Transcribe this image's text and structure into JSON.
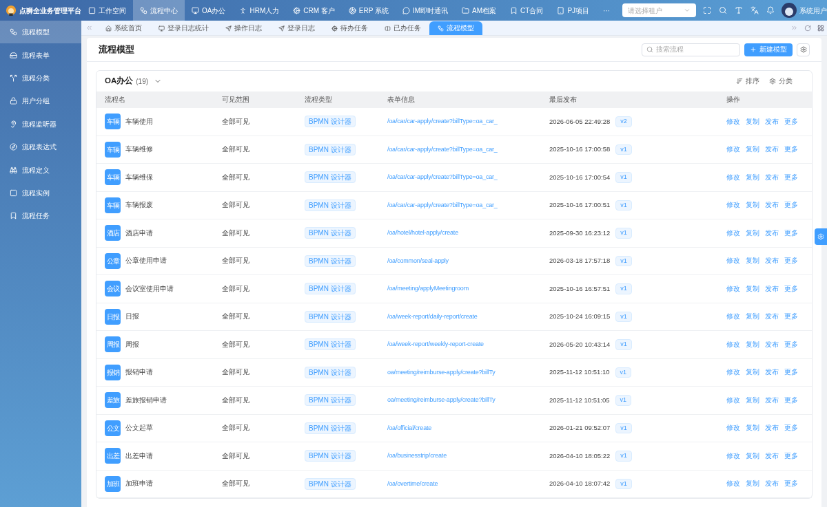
{
  "brand": {
    "title": "点狮全业务管理平台"
  },
  "top_nav": [
    {
      "label": "工作空间",
      "selected": false
    },
    {
      "label": "流程中心",
      "selected": true
    },
    {
      "label": "OA办公",
      "selected": false
    },
    {
      "label": "HRM人力",
      "selected": false
    },
    {
      "label": "CRM 客户",
      "selected": false
    },
    {
      "label": "ERP 系统",
      "selected": false
    },
    {
      "label": "IM即时通讯",
      "selected": false
    },
    {
      "label": "AM档案",
      "selected": false
    },
    {
      "label": "CT合同",
      "selected": false
    },
    {
      "label": "PJ项目",
      "selected": false
    },
    {
      "label": "···",
      "selected": false
    }
  ],
  "tenant_select": {
    "placeholder": "请选择租户"
  },
  "user": {
    "name": "系统用户"
  },
  "sidebar": {
    "items": [
      {
        "label": "流程模型",
        "selected": true
      },
      {
        "label": "流程表单",
        "selected": false
      },
      {
        "label": "流程分类",
        "selected": false
      },
      {
        "label": "用户分组",
        "selected": false
      },
      {
        "label": "流程监听器",
        "selected": false
      },
      {
        "label": "流程表达式",
        "selected": false
      },
      {
        "label": "流程定义",
        "selected": false
      },
      {
        "label": "流程实例",
        "selected": false
      },
      {
        "label": "流程任务",
        "selected": false
      }
    ]
  },
  "tabs": [
    {
      "label": "系统首页",
      "selected": false
    },
    {
      "label": "登录日志统计",
      "selected": false
    },
    {
      "label": "操作日志",
      "selected": false
    },
    {
      "label": "登录日志",
      "selected": false
    },
    {
      "label": "待办任务",
      "selected": false
    },
    {
      "label": "已办任务",
      "selected": false
    },
    {
      "label": "流程模型",
      "selected": true
    }
  ],
  "page": {
    "title": "流程模型",
    "search": {
      "placeholder": "搜索流程"
    },
    "new_button": "新建模型"
  },
  "group": {
    "name": "OA办公",
    "count": "(19)",
    "sort": "排序",
    "category": "分类",
    "columns": [
      "流程名",
      "可见范围",
      "流程类型",
      "表单信息",
      "最后发布",
      "操作"
    ],
    "rows": [
      {
        "badge": "车辆",
        "name": "车辆使用",
        "visibility": "全部可见",
        "type": "BPMN 设计器",
        "form": "/oa/car/car-apply/create?billType=oa_car_",
        "published": "2026-06-05 22:49:28",
        "version": "v2",
        "actions": [
          "修改",
          "复制",
          "发布",
          "更多"
        ]
      },
      {
        "badge": "车辆",
        "name": "车辆维修",
        "visibility": "全部可见",
        "type": "BPMN 设计器",
        "form": "/oa/car/car-apply/create?billType=oa_car_",
        "published": "2025-10-16 17:00:58",
        "version": "v1",
        "actions": [
          "修改",
          "复制",
          "发布",
          "更多"
        ]
      },
      {
        "badge": "车辆",
        "name": "车辆维保",
        "visibility": "全部可见",
        "type": "BPMN 设计器",
        "form": "/oa/car/car-apply/create?billType=oa_car_",
        "published": "2025-10-16 17:00:54",
        "version": "v1",
        "actions": [
          "修改",
          "复制",
          "发布",
          "更多"
        ]
      },
      {
        "badge": "车辆",
        "name": "车辆报废",
        "visibility": "全部可见",
        "type": "BPMN 设计器",
        "form": "/oa/car/car-apply/create?billType=oa_car_",
        "published": "2025-10-16 17:00:51",
        "version": "v1",
        "actions": [
          "修改",
          "复制",
          "发布",
          "更多"
        ]
      },
      {
        "badge": "酒店",
        "name": "酒店申请",
        "visibility": "全部可见",
        "type": "BPMN 设计器",
        "form": "/oa/hotel/hotel-apply/create",
        "published": "2025-09-30 16:23:12",
        "version": "v1",
        "actions": [
          "修改",
          "复制",
          "发布",
          "更多"
        ]
      },
      {
        "badge": "公章",
        "name": "公章使用申请",
        "visibility": "全部可见",
        "type": "BPMN 设计器",
        "form": "/oa/common/seal-apply",
        "published": "2026-03-18 17:57:18",
        "version": "v1",
        "actions": [
          "修改",
          "复制",
          "发布",
          "更多"
        ]
      },
      {
        "badge": "会议",
        "name": "会议室使用申请",
        "visibility": "全部可见",
        "type": "BPMN 设计器",
        "form": "/oa/meeting/applyMeetingroom",
        "published": "2025-10-16 16:57:51",
        "version": "v1",
        "actions": [
          "修改",
          "复制",
          "发布",
          "更多"
        ]
      },
      {
        "badge": "日报",
        "name": "日报",
        "visibility": "全部可见",
        "type": "BPMN 设计器",
        "form": "/oa/week-report/daily-report/create",
        "published": "2025-10-24 16:09:15",
        "version": "v1",
        "actions": [
          "修改",
          "复制",
          "发布",
          "更多"
        ]
      },
      {
        "badge": "周报",
        "name": "周报",
        "visibility": "全部可见",
        "type": "BPMN 设计器",
        "form": "/oa/week-report/weekly-report-create",
        "published": "2026-05-20 10:43:14",
        "version": "v1",
        "actions": [
          "修改",
          "复制",
          "发布",
          "更多"
        ]
      },
      {
        "badge": "报销",
        "name": "报销申请",
        "visibility": "全部可见",
        "type": "BPMN 设计器",
        "form": "oa/meeting/reimburse-apply/create?billTy",
        "published": "2025-11-12 10:51:10",
        "version": "v1",
        "actions": [
          "修改",
          "复制",
          "发布",
          "更多"
        ]
      },
      {
        "badge": "差旅",
        "name": "差旅报销申请",
        "visibility": "全部可见",
        "type": "BPMN 设计器",
        "form": "oa/meeting/reimburse-apply/create?billTy",
        "published": "2025-11-12 10:51:05",
        "version": "v1",
        "actions": [
          "修改",
          "复制",
          "发布",
          "更多"
        ]
      },
      {
        "badge": "公文",
        "name": "公文起草",
        "visibility": "全部可见",
        "type": "BPMN 设计器",
        "form": "/oa/official/create",
        "published": "2026-01-21 09:52:07",
        "version": "v1",
        "actions": [
          "修改",
          "复制",
          "发布",
          "更多"
        ]
      },
      {
        "badge": "出差",
        "name": "出差申请",
        "visibility": "全部可见",
        "type": "BPMN 设计器",
        "form": "/oa/businesstrip/create",
        "published": "2026-04-10 18:05:22",
        "version": "v1",
        "actions": [
          "修改",
          "复制",
          "发布",
          "更多"
        ]
      },
      {
        "badge": "加班",
        "name": "加班申请",
        "visibility": "全部可见",
        "type": "BPMN 设计器",
        "form": "/oa/overtime/create",
        "published": "2026-04-10 18:07:42",
        "version": "v1",
        "actions": [
          "修改",
          "复制",
          "发布",
          "更多"
        ]
      }
    ]
  }
}
